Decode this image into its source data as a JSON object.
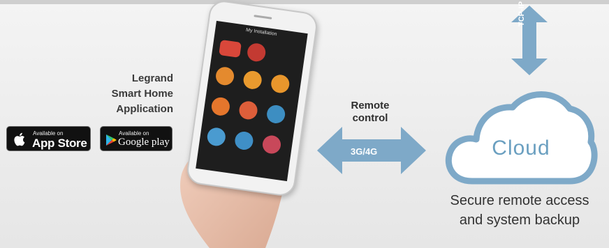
{
  "app": {
    "title_line1": "Legrand",
    "title_line2": "Smart Home",
    "title_line3": "Application"
  },
  "badges": {
    "appstore_small": "Available on",
    "appstore_big": "App Store",
    "google_small": "Available on",
    "google_big": "Google play"
  },
  "phone": {
    "screen_title": "My Installation"
  },
  "remote": {
    "line1": "Remote",
    "line2": "control",
    "arrow_label": "3G/4G"
  },
  "cloud": {
    "label": "Cloud",
    "link_label": "TCP-IP"
  },
  "caption": {
    "line1": "Secure remote access",
    "line2": "and system backup"
  },
  "colors": {
    "arrow_blue": "#7ea9c8",
    "cloud_fill": "#7ea9c8",
    "text_dark": "#333333"
  },
  "icons": [
    "apple-icon",
    "google-play-icon"
  ]
}
